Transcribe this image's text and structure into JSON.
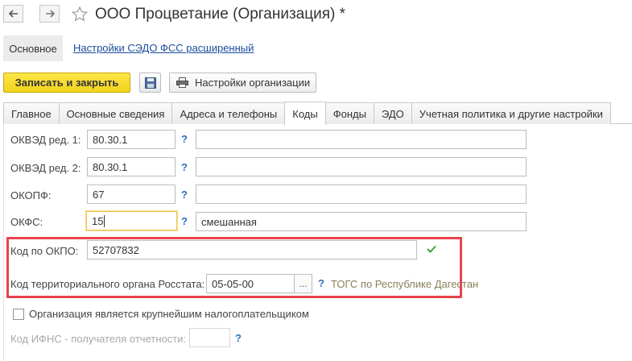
{
  "window": {
    "title": "ООО Процветание (Организация) *",
    "back_icon": "arrow-left-icon",
    "forward_icon": "arrow-right-icon",
    "favorite_icon": "star-icon"
  },
  "sections": {
    "main_label": "Основное",
    "link_label": "Настройки СЭДО ФСС расширенный"
  },
  "toolbar": {
    "save_close_label": "Записать и закрыть",
    "save_icon": "floppy-disk-icon",
    "org_settings_label": "Настройки организации",
    "org_settings_icon": "printer-icon"
  },
  "tabs": [
    {
      "label": "Главное",
      "active": false
    },
    {
      "label": "Основные сведения",
      "active": false
    },
    {
      "label": "Адреса и телефоны",
      "active": false
    },
    {
      "label": "Коды",
      "active": true
    },
    {
      "label": "Фонды",
      "active": false
    },
    {
      "label": "ЭДО",
      "active": false
    },
    {
      "label": "Учетная политика и другие настройки",
      "active": false
    }
  ],
  "form": {
    "okved1": {
      "label": "ОКВЭД ред. 1:",
      "value": "80.30.1",
      "help": "?",
      "description": ""
    },
    "okved2": {
      "label": "ОКВЭД ред. 2:",
      "value": "80.30.1",
      "help": "?",
      "description": ""
    },
    "okopf": {
      "label": "ОКОПФ:",
      "value": "67",
      "help": "?",
      "description": ""
    },
    "okfs": {
      "label": "ОКФС:",
      "value": "15",
      "help": "?",
      "description": "смешанная"
    },
    "okpo": {
      "label": "Код по ОКПО:",
      "value": "52707832",
      "valid_icon": "checkmark-icon"
    },
    "rosstat": {
      "label": "Код территориального органа Росстата:",
      "value": "05-05-00",
      "select_label": "...",
      "help": "?",
      "hint": "ТОГС по Республике Дагестан"
    },
    "largest_taxpayer": {
      "label": "Организация является крупнейшим налогоплательщиком",
      "checked": false
    },
    "ifns": {
      "label": "Код ИФНС - получателя отчетности:",
      "value": "",
      "help": "?"
    }
  },
  "colors": {
    "accent_yellow": "#f3d31b",
    "highlight_red": "#e8434b",
    "link_blue": "#1a4c9b",
    "help_blue": "#2a6ebb",
    "ok_green": "#3fa142"
  }
}
